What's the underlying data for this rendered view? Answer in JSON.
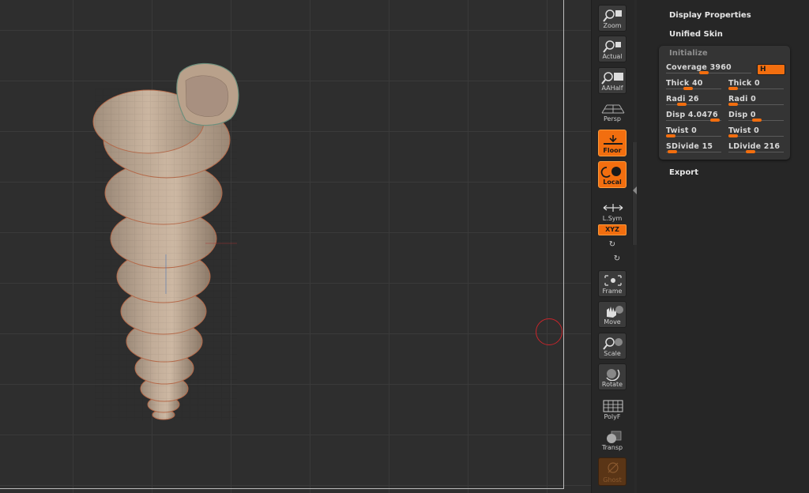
{
  "toolbar": {
    "zoom": "Zoom",
    "actual": "Actual",
    "aahalf": "AAHalf",
    "persp": "Persp",
    "floor": "Floor",
    "local": "Local",
    "lsym": "L.Sym",
    "xyz": "XYZ",
    "frame": "Frame",
    "move": "Move",
    "scale": "Scale",
    "rotate": "Rotate",
    "polyf": "PolyF",
    "transp": "Transp",
    "ghost": "Ghost"
  },
  "panel": {
    "display_properties": "Display Properties",
    "unified_skin": "Unified Skin",
    "initialize": {
      "title": "Initialize",
      "coverage": "Coverage 3960",
      "h_button": "H",
      "thick_left": "Thick 40",
      "thick_right": "Thick 0",
      "radi_left": "Radi 26",
      "radi_right": "Radi 0",
      "disp_left": "Disp 4.0476",
      "disp_right": "Disp 0",
      "twist_left": "Twist 0",
      "twist_right": "Twist 0",
      "sdivide": "SDivide 15",
      "ldivide": "LDivide 216"
    },
    "export": "Export"
  },
  "colors": {
    "accent": "#f26e0f",
    "background": "#2e2e2e",
    "panel": "#262626",
    "model_shell": "#c7a88f",
    "brush_cursor": "#c8252b"
  },
  "icons": [
    "zoom-icon",
    "actual-icon",
    "aahalf-icon",
    "persp-icon",
    "floor-icon",
    "local-icon",
    "lsym-icon",
    "rotate-y-icon",
    "rotate-z-icon",
    "frame-icon",
    "move-icon",
    "scale-icon",
    "rotate-icon",
    "polyf-icon",
    "transp-icon",
    "ghost-icon"
  ]
}
